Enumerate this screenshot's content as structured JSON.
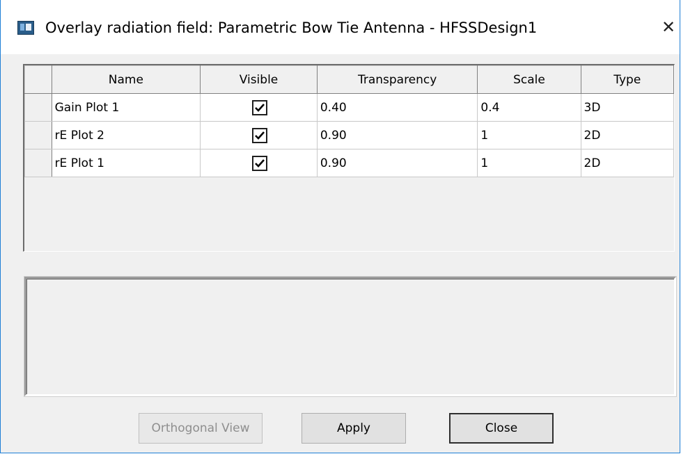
{
  "window": {
    "title": "Overlay radiation field: Parametric Bow Tie Antenna - HFSSDesign1",
    "close_glyph": "✕",
    "app_icon": "window-app-icon"
  },
  "grid": {
    "columns": [
      "Name",
      "Visible",
      "Transparency",
      "Scale",
      "Type"
    ],
    "rows": [
      {
        "name": "Gain Plot 1",
        "visible": true,
        "transparency": "0.40",
        "scale": "0.4",
        "type": "3D"
      },
      {
        "name": "rE Plot 2",
        "visible": true,
        "transparency": "0.90",
        "scale": "1",
        "type": "2D"
      },
      {
        "name": "rE Plot 1",
        "visible": true,
        "transparency": "0.90",
        "scale": "1",
        "type": "2D"
      }
    ]
  },
  "message_panel": {
    "text": ""
  },
  "buttons": {
    "orthogonal_view": "Orthogonal View",
    "apply": "Apply",
    "close": "Close"
  },
  "colors": {
    "window_border": "#1e7fd6",
    "dialog_bg": "#f0f0f0",
    "cell_bg": "#ffffff"
  }
}
